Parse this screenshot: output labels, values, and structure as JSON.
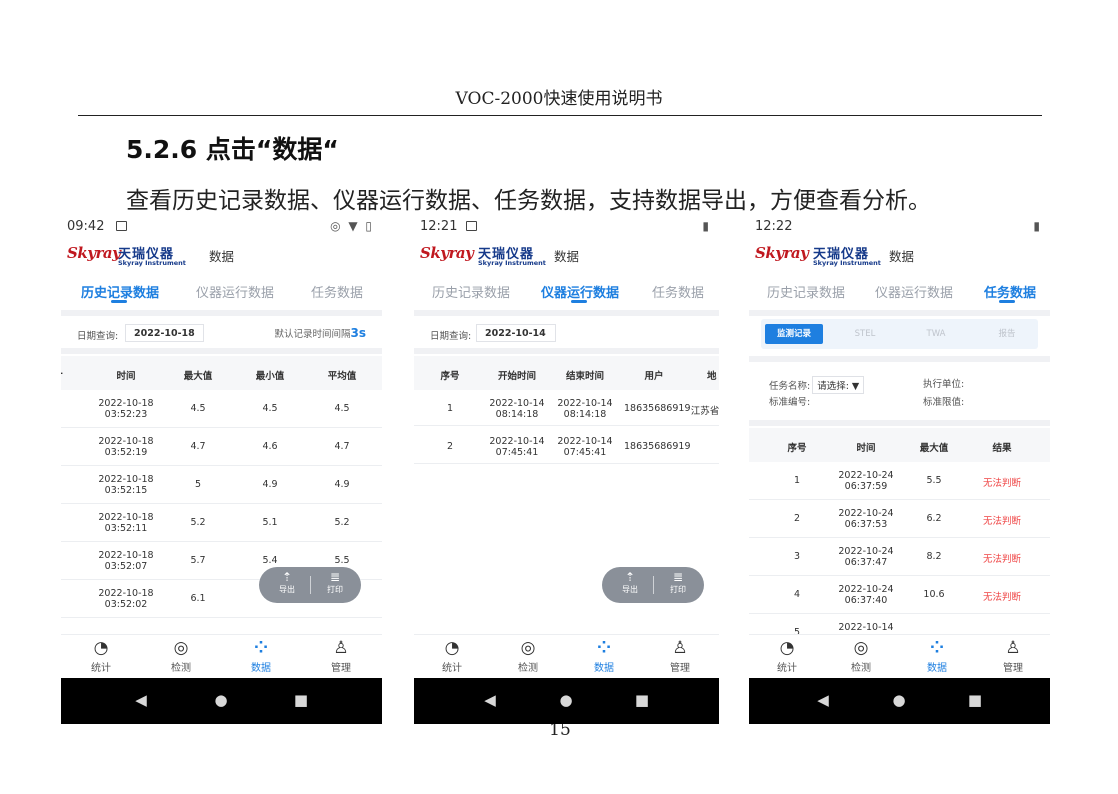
{
  "document": {
    "header": "VOC-2000快速使用说明书",
    "section_title": "5.2.6 点击“数据“",
    "description": "查看历史记录数据、仪器运行数据、任务数据，支持数据导出，方便查看分析。",
    "page_number": "15"
  },
  "app": {
    "logo_script": "Skyray",
    "logo_cn": "天瑞仪器",
    "logo_en": "Skyray Instrument",
    "title": "数据",
    "tabs": [
      "历史记录数据",
      "仪器运行数据",
      "任务数据"
    ],
    "nav": [
      {
        "label": "统计",
        "icon": "pie-chart-icon"
      },
      {
        "label": "检测",
        "icon": "target-icon"
      },
      {
        "label": "数据",
        "icon": "grid-icon"
      },
      {
        "label": "管理",
        "icon": "user-icon"
      }
    ],
    "fab": {
      "export": "导出",
      "print": "打印"
    },
    "colors": {
      "accent": "#1e7fe0",
      "red": "#ef4444",
      "logo_red": "#c0181f",
      "logo_blue": "#163a8a"
    }
  },
  "screen1": {
    "time": "09:42",
    "status_right": "◎ ▼ ▯",
    "date_label": "日期查询:",
    "date_value": "2022-10-18",
    "hint_prefix": "默认记录时间间隔",
    "hint_value": "3s",
    "columns": [
      "时间",
      "最大值",
      "最小值",
      "平均值"
    ],
    "rows": [
      {
        "date": "2022-10-18",
        "time": "03:52:23",
        "max": "4.5",
        "min": "4.5",
        "avg": "4.5"
      },
      {
        "date": "2022-10-18",
        "time": "03:52:19",
        "max": "4.7",
        "min": "4.6",
        "avg": "4.7"
      },
      {
        "date": "2022-10-18",
        "time": "03:52:15",
        "max": "5",
        "min": "4.9",
        "avg": "4.9"
      },
      {
        "date": "2022-10-18",
        "time": "03:52:11",
        "max": "5.2",
        "min": "5.1",
        "avg": "5.2"
      },
      {
        "date": "2022-10-18",
        "time": "03:52:07",
        "max": "5.7",
        "min": "5.4",
        "avg": "5.5"
      },
      {
        "date": "2022-10-18",
        "time": "03:52:02",
        "max": "6.1",
        "min": "",
        "avg": ""
      }
    ]
  },
  "screen2": {
    "time": "12:21",
    "date_label": "日期查询:",
    "date_value": "2022-10-14",
    "columns": [
      "序号",
      "开始时间",
      "结束时间",
      "用户",
      "地"
    ],
    "rows": [
      {
        "no": "1",
        "start_date": "2022-10-14",
        "start_time": "08:14:18",
        "end_date": "2022-10-14",
        "end_time": "08:14:18",
        "user": "18635686919",
        "place": "江苏省"
      },
      {
        "no": "2",
        "start_date": "2022-10-14",
        "start_time": "07:45:41",
        "end_date": "2022-10-14",
        "end_time": "07:45:41",
        "user": "18635686919",
        "place": ""
      }
    ]
  },
  "screen3": {
    "time": "12:22",
    "segments": [
      "监测记录",
      "STEL",
      "TWA",
      "报告"
    ],
    "task_name_label": "任务名称:",
    "task_name_value": "请选择: ▼",
    "exec_unit_label": "执行单位:",
    "std_no_label": "标准编号:",
    "std_limit_label": "标准限值:",
    "columns": [
      "序号",
      "时间",
      "最大值",
      "结果"
    ],
    "rows": [
      {
        "no": "1",
        "date": "2022-10-24",
        "time": "06:37:59",
        "max": "5.5",
        "result": "无法判断"
      },
      {
        "no": "2",
        "date": "2022-10-24",
        "time": "06:37:53",
        "max": "6.2",
        "result": "无法判断"
      },
      {
        "no": "3",
        "date": "2022-10-24",
        "time": "06:37:47",
        "max": "8.2",
        "result": "无法判断"
      },
      {
        "no": "4",
        "date": "2022-10-24",
        "time": "06:37:40",
        "max": "10.6",
        "result": "无法判断"
      },
      {
        "no": "5",
        "date": "2022-10-14",
        "time": "",
        "max": "",
        "result": ""
      }
    ]
  }
}
